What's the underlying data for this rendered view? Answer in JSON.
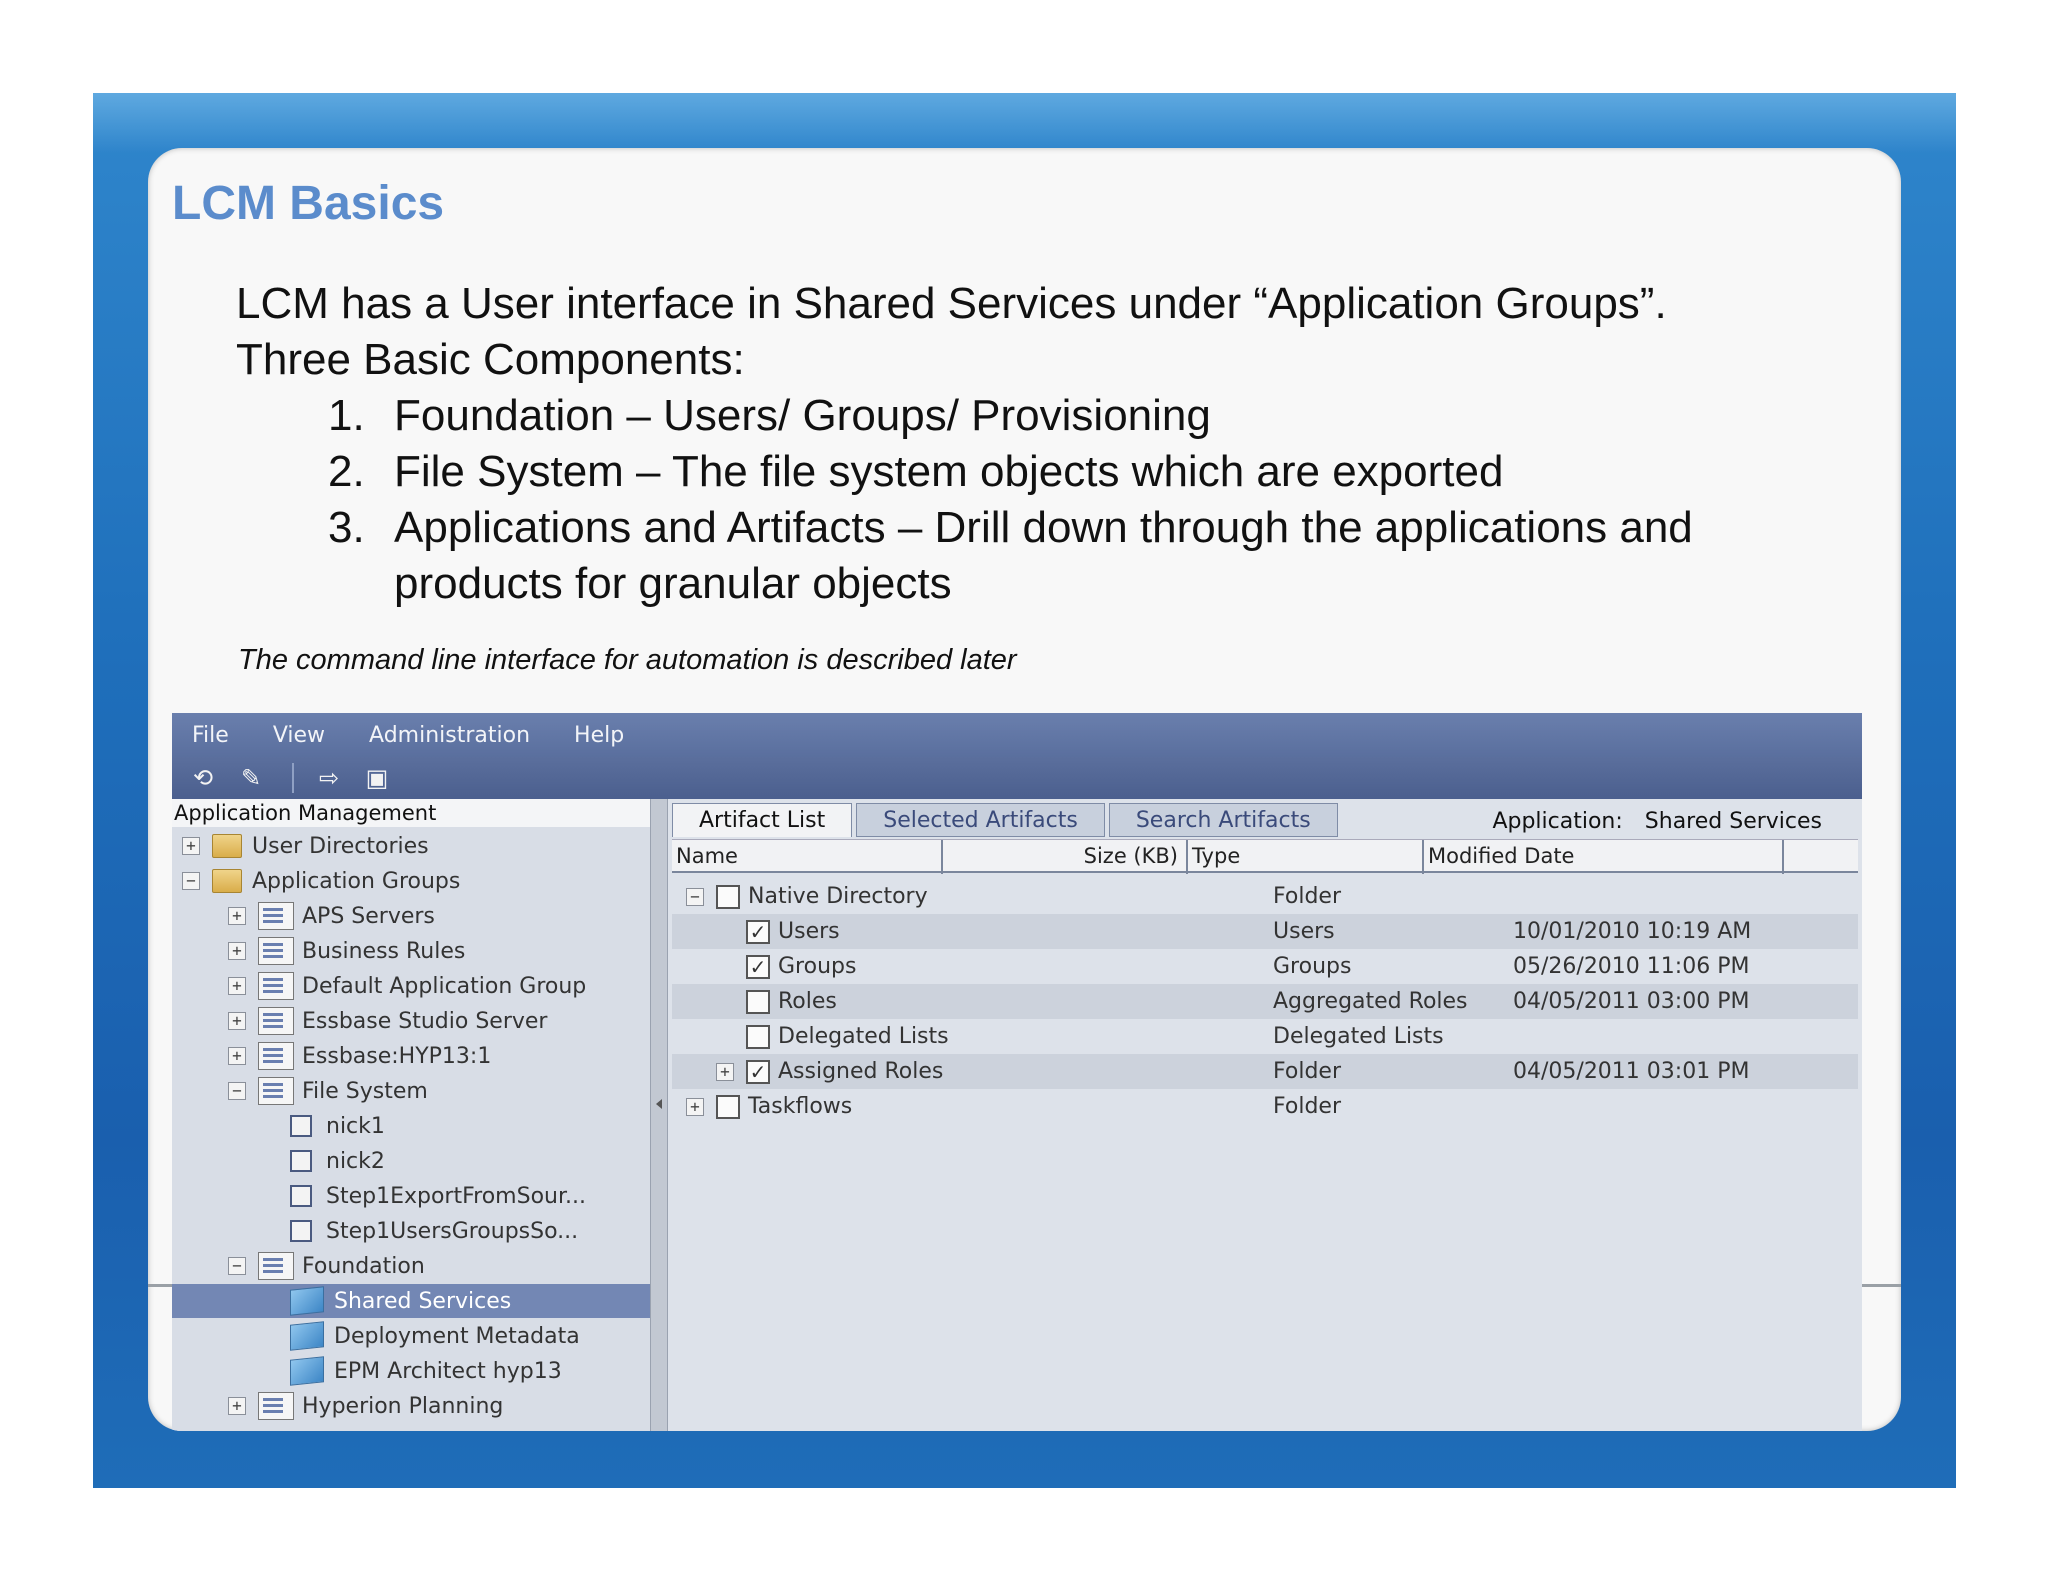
{
  "slide": {
    "title": "LCM Basics",
    "intro_line1": "LCM has a User interface in Shared Services under “Application Groups”.",
    "intro_line2": "Three Basic Components:",
    "components": [
      {
        "num": "1.",
        "text": "Foundation – Users/ Groups/ Provisioning"
      },
      {
        "num": "2.",
        "text": "File System – The file system objects which are exported"
      },
      {
        "num": "3.",
        "text": "Applications and Artifacts – Drill down through the applications and",
        "text2": "products for granular objects"
      }
    ],
    "note": "The command line interface for automation is described later"
  },
  "menu": [
    "File",
    "View",
    "Administration",
    "Help"
  ],
  "toolbar": [
    "refresh-icon",
    "edit-icon",
    "export-icon",
    "import-icon"
  ],
  "left_pane": {
    "header": "Application Management",
    "tree": [
      {
        "label": "User Directories",
        "exp": "+",
        "icon": "folder"
      },
      {
        "label": "Application Groups",
        "exp": "−",
        "icon": "folder"
      },
      {
        "label": "APS Servers",
        "exp": "+",
        "icon": "group"
      },
      {
        "label": "Business Rules",
        "exp": "+",
        "icon": "group"
      },
      {
        "label": "Default Application Group",
        "exp": "+",
        "icon": "group"
      },
      {
        "label": "Essbase Studio Server",
        "exp": "+",
        "icon": "group"
      },
      {
        "label": "Essbase:HYP13:1",
        "exp": "+",
        "icon": "group"
      },
      {
        "label": "File System",
        "exp": "−",
        "icon": "group"
      },
      {
        "label": "nick1",
        "icon": "file"
      },
      {
        "label": "nick2",
        "icon": "file"
      },
      {
        "label": "Step1ExportFromSour...",
        "icon": "file"
      },
      {
        "label": "Step1UsersGroupsSo...",
        "icon": "file"
      },
      {
        "label": "Foundation",
        "exp": "−",
        "icon": "group"
      },
      {
        "label": "Shared Services",
        "icon": "cube",
        "selected": true
      },
      {
        "label": "Deployment Metadata",
        "icon": "cube"
      },
      {
        "label": "EPM Architect hyp13",
        "icon": "cube"
      },
      {
        "label": "Hyperion Planning",
        "exp": "+",
        "icon": "group"
      }
    ]
  },
  "right_pane": {
    "tabs": [
      "Artifact List",
      "Selected Artifacts",
      "Search Artifacts"
    ],
    "application_label": "Application:",
    "application_value": "Shared Services",
    "columns": [
      "Name",
      "Size (KB)",
      "Type",
      "Modified Date"
    ],
    "rows": [
      {
        "name": "Native Directory",
        "exp": "−",
        "checked": false,
        "type": "Folder",
        "date": ""
      },
      {
        "name": "Users",
        "checked": true,
        "type": "Users",
        "date": "10/01/2010 10:19 AM"
      },
      {
        "name": "Groups",
        "checked": true,
        "type": "Groups",
        "date": "05/26/2010 11:06 PM"
      },
      {
        "name": "Roles",
        "checked": false,
        "type": "Aggregated Roles",
        "date": "04/05/2011 03:00 PM"
      },
      {
        "name": "Delegated Lists",
        "checked": false,
        "type": "Delegated Lists",
        "date": ""
      },
      {
        "name": "Assigned Roles",
        "exp": "+",
        "checked": true,
        "type": "Folder",
        "date": "04/05/2011 03:01 PM"
      },
      {
        "name": "Taskflows",
        "exp": "+",
        "checked": false,
        "type": "Folder",
        "date": ""
      }
    ]
  }
}
